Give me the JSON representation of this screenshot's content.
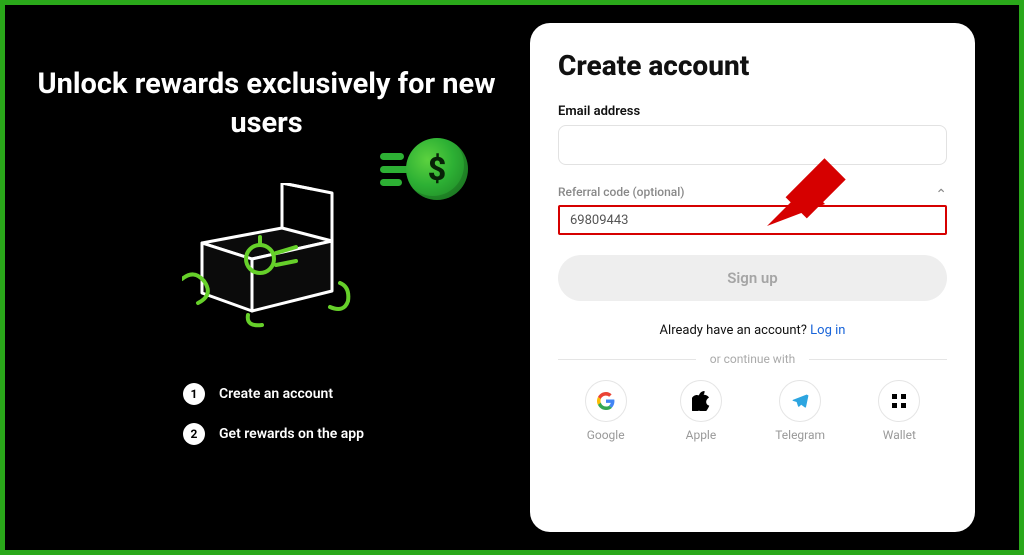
{
  "colors": {
    "accent": "#2aa81a",
    "highlight": "#d60000"
  },
  "hero": {
    "title": "Unlock rewards exclusively for new users",
    "steps": [
      {
        "num": "1",
        "text": "Create an account"
      },
      {
        "num": "2",
        "text": "Get rewards on the app"
      }
    ]
  },
  "form": {
    "title": "Create account",
    "email_label": "Email address",
    "email_value": "",
    "referral_label": "Referral code (optional)",
    "referral_value": "69809443",
    "signup_label": "Sign up",
    "already_text": "Already have an account? ",
    "login_label": "Log in",
    "continue_text": "or continue with",
    "providers": [
      {
        "id": "google",
        "label": "Google"
      },
      {
        "id": "apple",
        "label": "Apple"
      },
      {
        "id": "telegram",
        "label": "Telegram"
      },
      {
        "id": "wallet",
        "label": "Wallet"
      }
    ]
  }
}
